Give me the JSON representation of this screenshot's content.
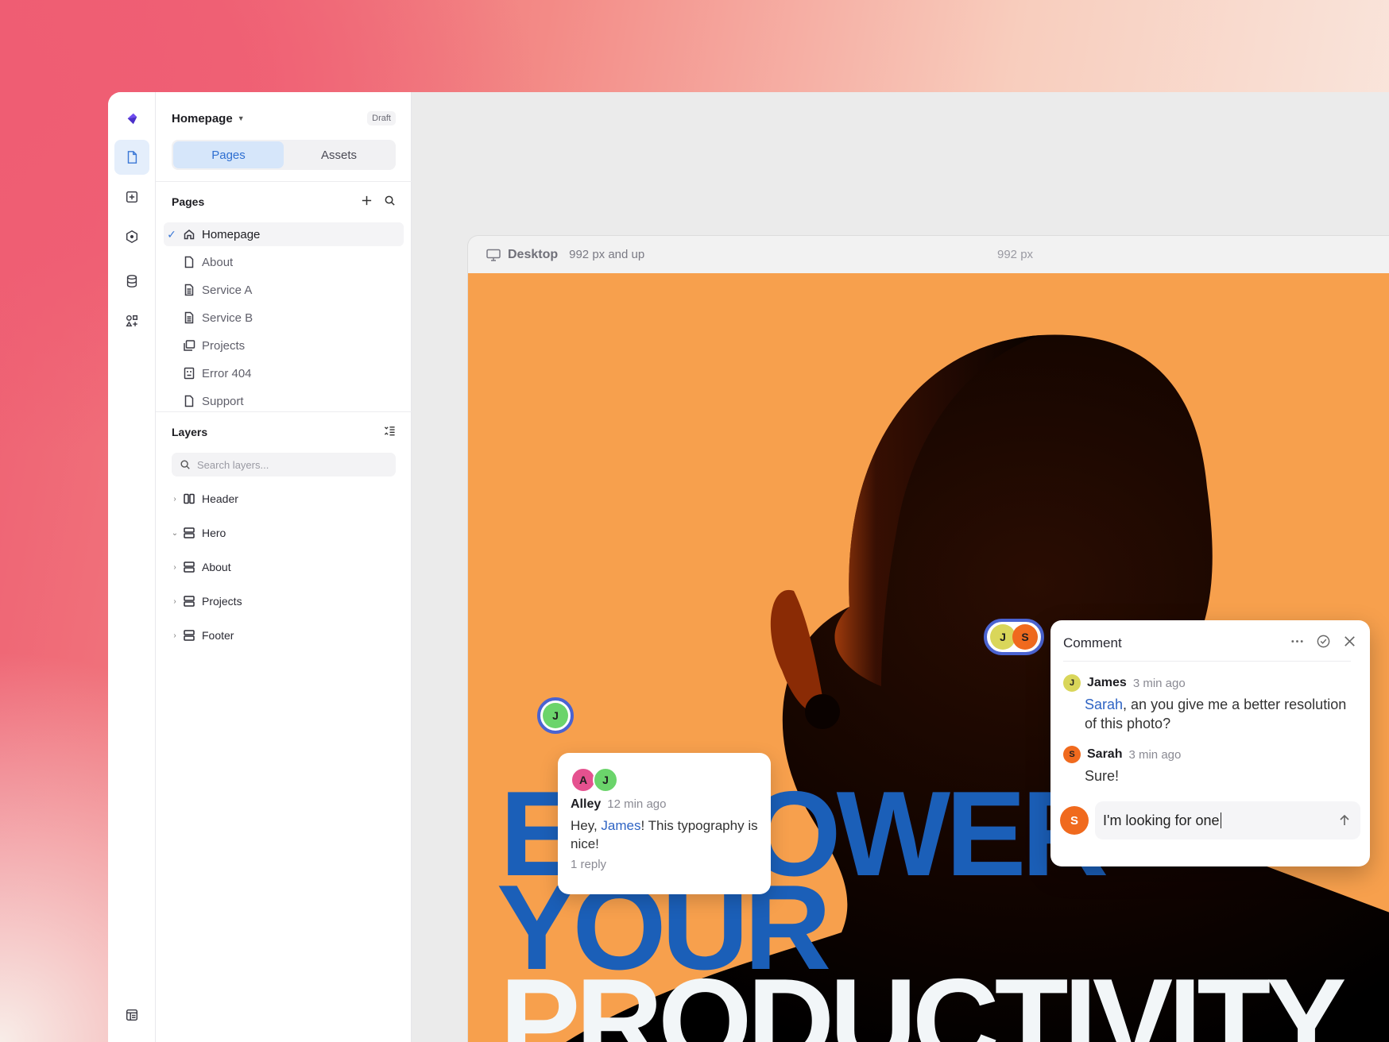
{
  "app": {
    "page_title": "Homepage",
    "status_badge": "Draft",
    "tabs": [
      {
        "label": "Pages",
        "active": true
      },
      {
        "label": "Assets",
        "active": false
      }
    ],
    "rail_icons": [
      "pages-icon",
      "add-element-icon",
      "components-icon",
      "database-icon",
      "widgets-icon",
      "layout-icon"
    ]
  },
  "pages_section": {
    "title": "Pages",
    "items": [
      {
        "label": "Homepage",
        "icon": "home-icon",
        "selected": true
      },
      {
        "label": "About",
        "icon": "page-icon"
      },
      {
        "label": "Service A",
        "icon": "page-text-icon"
      },
      {
        "label": "Service B",
        "icon": "page-text-icon"
      },
      {
        "label": "Projects",
        "icon": "collection-icon"
      },
      {
        "label": "Error 404",
        "icon": "error-page-icon"
      },
      {
        "label": "Support",
        "icon": "page-icon"
      }
    ]
  },
  "layers_section": {
    "title": "Layers",
    "search_placeholder": "Search layers...",
    "items": [
      {
        "label": "Header",
        "icon": "columns-icon",
        "expanded": false
      },
      {
        "label": "Hero",
        "icon": "rows-icon",
        "expanded": true
      },
      {
        "label": "About",
        "icon": "rows-icon",
        "expanded": false
      },
      {
        "label": "Projects",
        "icon": "rows-icon",
        "expanded": false
      },
      {
        "label": "Footer",
        "icon": "rows-icon",
        "expanded": false
      }
    ]
  },
  "canvas": {
    "breakpoint_name": "Desktop",
    "breakpoint_range": "992 px and up",
    "breakpoint_width": "992 px",
    "hero_lines": [
      "EMPOWER",
      "YOUR",
      "PRODUCTIVITY"
    ]
  },
  "pins": {
    "single": "J",
    "pair": [
      "J",
      "S"
    ]
  },
  "bubble": {
    "avatars": [
      "A",
      "J"
    ],
    "author": "Alley",
    "time": "12 min ago",
    "text_before": "Hey, ",
    "mention": "James",
    "text_after": "! This typography is nice!",
    "replies": "1 reply"
  },
  "comment_panel": {
    "title": "Comment",
    "comments": [
      {
        "initial": "J",
        "author": "James",
        "time": "3 min ago",
        "mention": "Sarah",
        "text": ", an you give me a better resolution of this photo?"
      },
      {
        "initial": "S",
        "author": "Sarah",
        "time": "3 min ago",
        "text": "Sure!"
      }
    ],
    "reply_initial": "S",
    "reply_value": "I'm looking for one"
  },
  "colors": {
    "accent": "#3b78d6",
    "hero_blue": "#1b5fb8",
    "hero_bg": "#f7a04d",
    "avatar_j": "#d9d65a",
    "avatar_s": "#f06a1e",
    "avatar_a": "#e5518f",
    "avatar_j_green": "#6bd46b"
  }
}
